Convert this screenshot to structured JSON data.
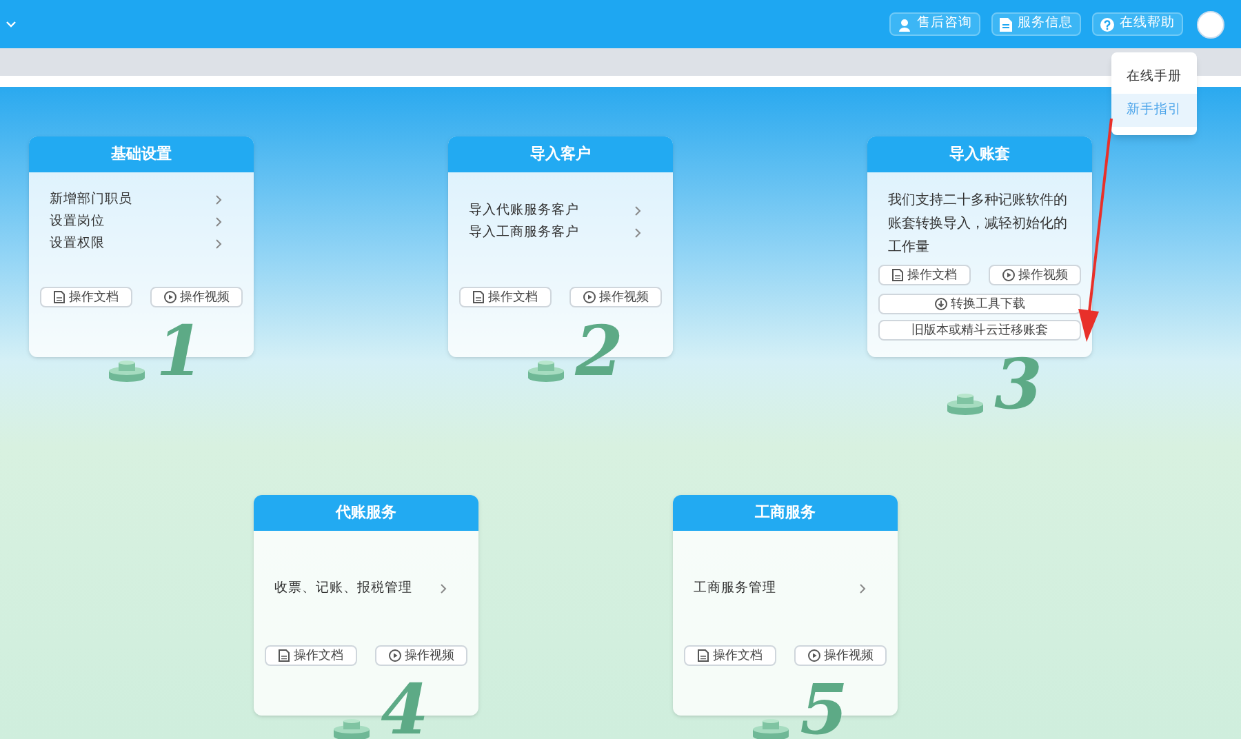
{
  "header": {
    "buttons": [
      {
        "label": "售后咨询"
      },
      {
        "label": "服务信息"
      },
      {
        "label": "在线帮助"
      }
    ]
  },
  "help_menu": {
    "items": [
      {
        "label": "在线手册",
        "selected": false
      },
      {
        "label": "新手指引",
        "selected": true
      }
    ]
  },
  "rows": [
    [
      {
        "title": "基础设置",
        "step": "1",
        "items": [
          {
            "label": "新增部门职员"
          },
          {
            "label": "设置岗位"
          },
          {
            "label": "设置权限"
          }
        ],
        "buttons": [
          {
            "label": "操作文档",
            "kind": "doc"
          },
          {
            "label": "操作视频",
            "kind": "video"
          }
        ]
      },
      {
        "title": "导入客户",
        "step": "2",
        "items": [
          {
            "label": "导入代账服务客户"
          },
          {
            "label": "导入工商服务客户"
          }
        ],
        "buttons": [
          {
            "label": "操作文档",
            "kind": "doc"
          },
          {
            "label": "操作视频",
            "kind": "video"
          }
        ]
      },
      {
        "title": "导入账套",
        "step": "3",
        "text": "我们支持二十多种记账软件的账套转换导入，减轻初始化的工作量",
        "buttons": [
          {
            "label": "操作文档",
            "kind": "doc"
          },
          {
            "label": "操作视频",
            "kind": "video"
          },
          {
            "label": "转换工具下载",
            "kind": "download"
          },
          {
            "label": "旧版本或精斗云迁移账套",
            "kind": "plain"
          }
        ]
      }
    ],
    [
      {
        "title": "代账服务",
        "step": "4",
        "items": [
          {
            "label": "收票、记账、报税管理"
          }
        ],
        "buttons": [
          {
            "label": "操作文档",
            "kind": "doc"
          },
          {
            "label": "操作视频",
            "kind": "video"
          }
        ]
      },
      {
        "title": "工商服务",
        "step": "5",
        "items": [
          {
            "label": "工商服务管理"
          }
        ],
        "buttons": [
          {
            "label": "操作文档",
            "kind": "doc"
          },
          {
            "label": "操作视频",
            "kind": "video"
          }
        ]
      }
    ]
  ]
}
